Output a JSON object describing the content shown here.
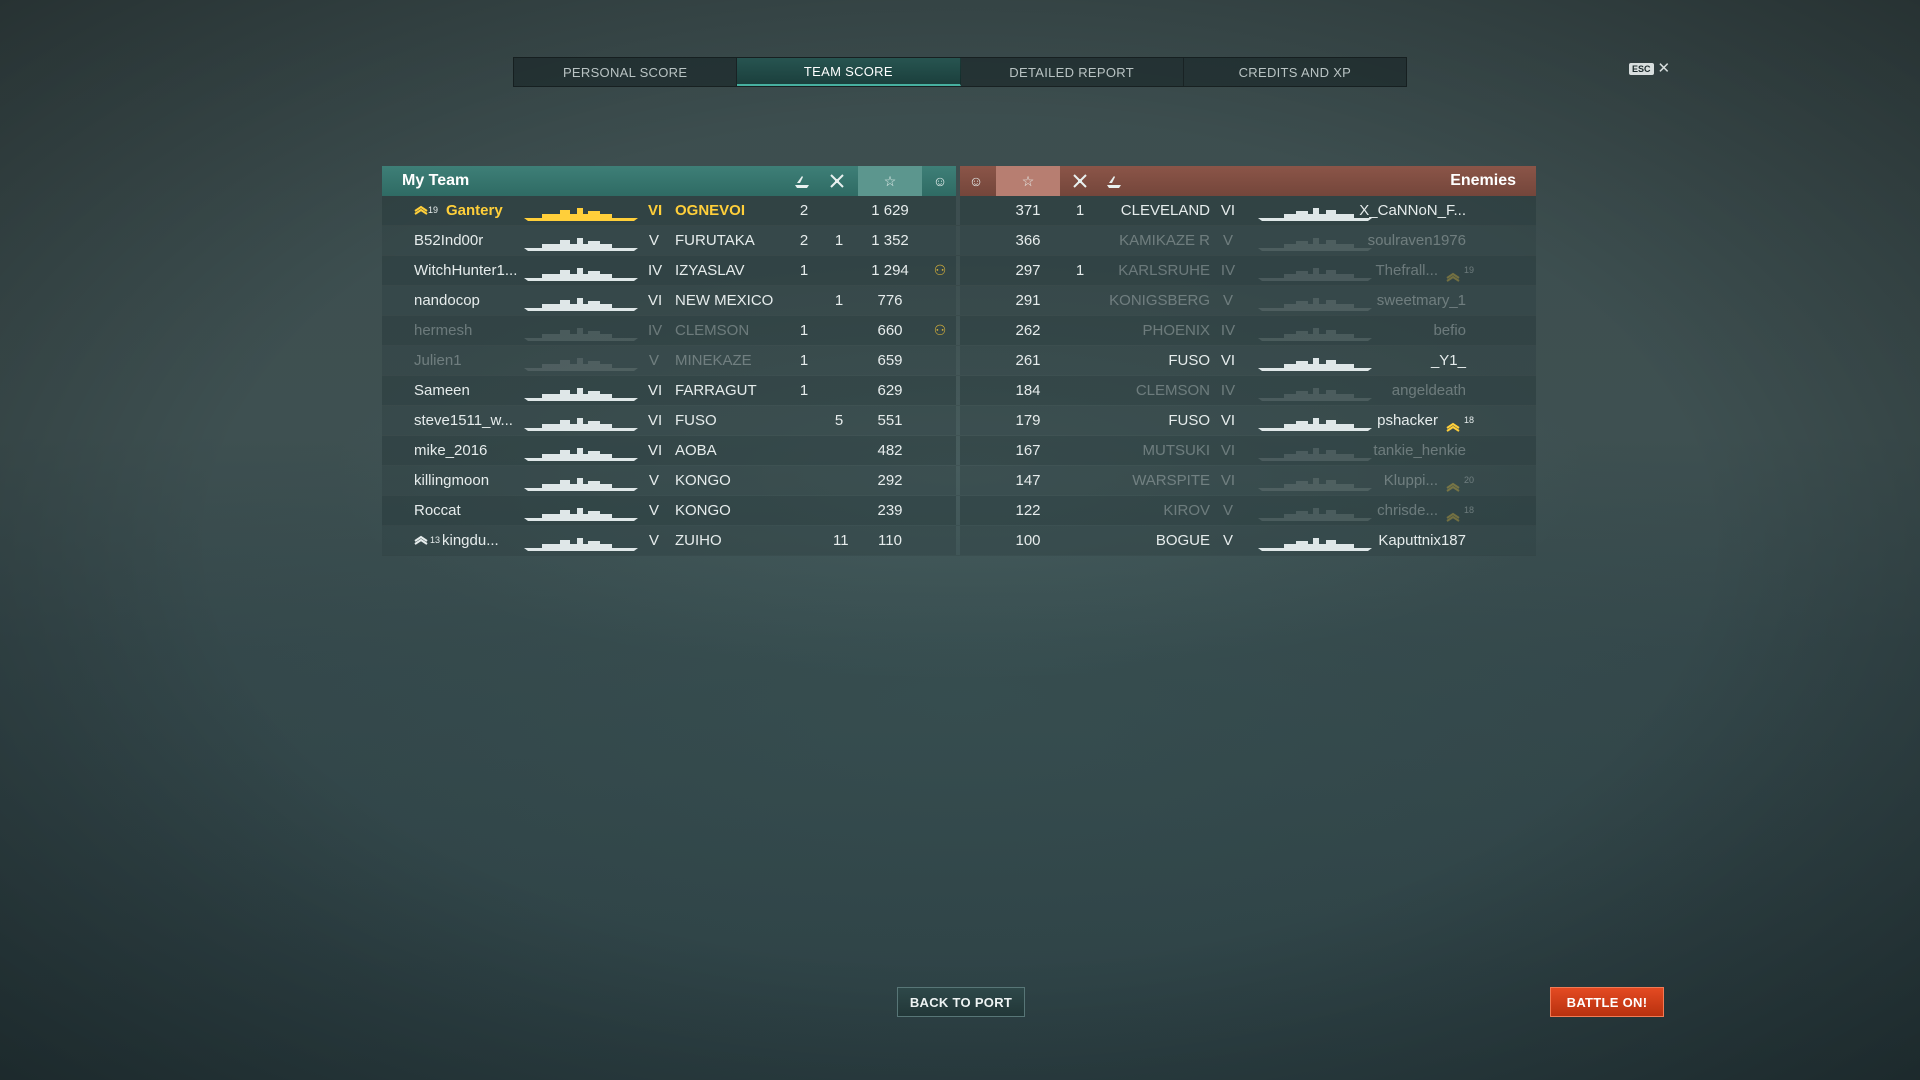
{
  "tabs": [
    {
      "label": "PERSONAL SCORE",
      "active": false
    },
    {
      "label": "TEAM SCORE",
      "active": true
    },
    {
      "label": "DETAILED REPORT",
      "active": false
    },
    {
      "label": "CREDITS AND XP",
      "active": false
    }
  ],
  "close": {
    "key": "ESC",
    "glyph": "✕"
  },
  "my_team": {
    "title": "My Team",
    "header_icons": [
      "ships-sunk-icon",
      "planes-destroyed-icon",
      "star-score-icon",
      "achievement-icon"
    ],
    "rows": [
      {
        "rank": "19",
        "name": "Gantery",
        "tier": "VI",
        "ship": "OGNEVOI",
        "k1": "2",
        "k2": "",
        "score": "1 629",
        "badge": "",
        "me": true,
        "dead": false
      },
      {
        "rank": "",
        "name": "B52Ind00r",
        "tier": "V",
        "ship": "FURUTAKA",
        "k1": "2",
        "k2": "1",
        "score": "1 352",
        "badge": "",
        "me": false,
        "dead": false
      },
      {
        "rank": "",
        "name": "WitchHunter1...",
        "tier": "IV",
        "ship": "IZYASLAV",
        "k1": "1",
        "k2": "",
        "score": "1 294",
        "badge": "⚇",
        "me": false,
        "dead": false
      },
      {
        "rank": "",
        "name": "nandocop",
        "tier": "VI",
        "ship": "NEW MEXICO",
        "k1": "",
        "k2": "1",
        "score": "776",
        "badge": "",
        "me": false,
        "dead": false
      },
      {
        "rank": "",
        "name": "hermesh",
        "tier": "IV",
        "ship": "CLEMSON",
        "k1": "1",
        "k2": "",
        "score": "660",
        "badge": "⚇",
        "me": false,
        "dead": true
      },
      {
        "rank": "",
        "name": "Julien1",
        "tier": "V",
        "ship": "MINEKAZE",
        "k1": "1",
        "k2": "",
        "score": "659",
        "badge": "",
        "me": false,
        "dead": true
      },
      {
        "rank": "",
        "name": "Sameen",
        "tier": "VI",
        "ship": "FARRAGUT",
        "k1": "1",
        "k2": "",
        "score": "629",
        "badge": "",
        "me": false,
        "dead": false
      },
      {
        "rank": "",
        "name": "steve1511_w...",
        "tier": "VI",
        "ship": "FUSO",
        "k1": "",
        "k2": "5",
        "score": "551",
        "badge": "",
        "me": false,
        "dead": false
      },
      {
        "rank": "",
        "name": "mike_2016",
        "tier": "VI",
        "ship": "AOBA",
        "k1": "",
        "k2": "",
        "score": "482",
        "badge": "",
        "me": false,
        "dead": false
      },
      {
        "rank": "",
        "name": "killingmoon",
        "tier": "V",
        "ship": "KONGO",
        "k1": "",
        "k2": "",
        "score": "292",
        "badge": "",
        "me": false,
        "dead": false
      },
      {
        "rank": "",
        "name": "Roccat",
        "tier": "V",
        "ship": "KONGO",
        "k1": "",
        "k2": "",
        "score": "239",
        "badge": "",
        "me": false,
        "dead": false
      },
      {
        "rank": "13",
        "name": "kingdu...",
        "tier": "V",
        "ship": "ZUIHO",
        "k1": "",
        "k2": "11",
        "score": "110",
        "badge": "",
        "me": false,
        "dead": false
      }
    ]
  },
  "enemies": {
    "title": "Enemies",
    "header_icons": [
      "achievement-icon",
      "star-score-icon",
      "planes-destroyed-icon",
      "ships-sunk-icon"
    ],
    "rows": [
      {
        "score": "371",
        "k2": "1",
        "ship": "CLEVELAND",
        "tier": "VI",
        "name": "X_CaNNoN_F...",
        "rank": "",
        "dead": false
      },
      {
        "score": "366",
        "k2": "",
        "ship": "KAMIKAZE R",
        "tier": "V",
        "name": "soulraven1976",
        "rank": "",
        "dead": true
      },
      {
        "score": "297",
        "k2": "1",
        "ship": "KARLSRUHE",
        "tier": "IV",
        "name": "Thefrall...",
        "rank": "19",
        "dead": true
      },
      {
        "score": "291",
        "k2": "",
        "ship": "KONIGSBERG",
        "tier": "V",
        "name": "sweetmary_1",
        "rank": "",
        "dead": true
      },
      {
        "score": "262",
        "k2": "",
        "ship": "PHOENIX",
        "tier": "IV",
        "name": "befio",
        "rank": "",
        "dead": true
      },
      {
        "score": "261",
        "k2": "",
        "ship": "FUSO",
        "tier": "VI",
        "name": "_Y1_",
        "rank": "",
        "dead": false
      },
      {
        "score": "184",
        "k2": "",
        "ship": "CLEMSON",
        "tier": "IV",
        "name": "angeldeath",
        "rank": "",
        "dead": true
      },
      {
        "score": "179",
        "k2": "",
        "ship": "FUSO",
        "tier": "VI",
        "name": "pshacker",
        "rank": "18",
        "dead": false
      },
      {
        "score": "167",
        "k2": "",
        "ship": "MUTSUKI",
        "tier": "VI",
        "name": "tankie_henkie",
        "rank": "",
        "dead": true
      },
      {
        "score": "147",
        "k2": "",
        "ship": "WARSPITE",
        "tier": "VI",
        "name": "Kluppi...",
        "rank": "20",
        "dead": true
      },
      {
        "score": "122",
        "k2": "",
        "ship": "KIROV",
        "tier": "V",
        "name": "chrisde...",
        "rank": "18",
        "dead": true
      },
      {
        "score": "100",
        "k2": "",
        "ship": "BOGUE",
        "tier": "V",
        "name": "Kaputtnix187",
        "rank": "",
        "dead": false
      }
    ]
  },
  "buttons": {
    "back": "BACK TO PORT",
    "battle": "BATTLE ON!"
  },
  "colors": {
    "my_team": "#347069",
    "enemies": "#7d4b3f",
    "player": "#ffcf3a",
    "battle_button": "#d23e18"
  }
}
